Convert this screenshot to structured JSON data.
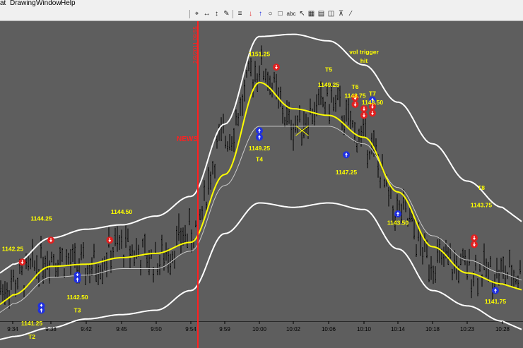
{
  "menu": {
    "items": [
      "at",
      "Drawing",
      "Window",
      "Help"
    ]
  },
  "toolbar": {
    "tools": [
      "crosshair-icon",
      "horizontal-arrows-icon",
      "vertical-arrows-icon",
      "pencil-icon",
      "lines-icon",
      "down-arrow-icon",
      "up-arrow-icon",
      "circle-icon",
      "square-icon",
      "text-icon",
      "pointer-icon",
      "grid-icon",
      "table-icon",
      "chart-icon",
      "magnet-icon"
    ],
    "text_tool_label": "abc"
  },
  "colors": {
    "background": "#5e5e5e",
    "bars": "#000000",
    "sma": "#ffff00",
    "ema": "#cccccc",
    "bands": "#ffffff",
    "news_line": "#ff2020",
    "sell": "#e02020",
    "buy": "#2030e0",
    "label": "#ffff00"
  },
  "news": {
    "label": "NEWS",
    "time": "9:54",
    "stamp": "2/9/2011 09:55"
  },
  "chart_data": {
    "type": "line",
    "title": "",
    "xlabel": "",
    "ylabel": "",
    "x": [
      "9:34",
      "9:38",
      "9:42",
      "9:45",
      "9:50",
      "9:54",
      "9:59",
      "10:00",
      "10:02",
      "10:06",
      "10:10",
      "10:14",
      "10:18",
      "10:23",
      "10:28"
    ],
    "ylim": [
      1139.6,
      1153.3
    ],
    "series": [
      {
        "values": [
          1141.4,
          1142.6,
          1142.0,
          1143.0,
          1142.4,
          1143.6,
          1148.0,
          1151.2,
          1148.6,
          1149.6,
          1148.0,
          1144.6,
          1142.4,
          1142.0,
          1141.8
        ]
      }
    ],
    "sma": [
      1140.8,
      1142.1,
      1142.2,
      1142.5,
      1142.7,
      1143.2,
      1146.3,
      1150.5,
      1149.3,
      1149.0,
      1148.0,
      1145.5,
      1143.0,
      1141.8,
      1141.3
    ],
    "ema": [
      1140.4,
      1141.6,
      1141.7,
      1142.0,
      1142.0,
      1142.8,
      1145.8,
      1148.5,
      1148.5,
      1148.5,
      1147.7,
      1145.7,
      1143.5,
      1142.4,
      1141.8
    ],
    "upper": [
      1142.2,
      1143.4,
      1143.8,
      1144.0,
      1144.4,
      1145.3,
      1148.6,
      1152.6,
      1152.7,
      1152.4,
      1151.3,
      1149.6,
      1147.7,
      1146.0,
      1144.8
    ],
    "lower": [
      1138.9,
      1139.3,
      1139.7,
      1139.9,
      1140.1,
      1141.0,
      1143.6,
      1145.0,
      1144.8,
      1145.0,
      1144.7,
      1142.9,
      1141.0,
      1140.3,
      1139.6
    ],
    "signals": [
      {
        "type": "sell",
        "time": "9:35",
        "price": 1142.3
      },
      {
        "type": "buy",
        "time": "9:37",
        "price": 1140.3
      },
      {
        "type": "buy",
        "time": "9:37",
        "price": 1140.1
      },
      {
        "type": "sell",
        "time": "9:38",
        "price": 1143.3
      },
      {
        "type": "buy",
        "time": "9:41",
        "price": 1141.7
      },
      {
        "type": "buy",
        "time": "9:41",
        "price": 1141.5
      },
      {
        "type": "sell",
        "time": "9:44",
        "price": 1143.3
      },
      {
        "type": "buy",
        "time": "10:00",
        "price": 1148.3
      },
      {
        "type": "buy",
        "time": "10:00",
        "price": 1148.0
      },
      {
        "type": "sell",
        "time": "10:01",
        "price": 1151.2
      },
      {
        "type": "buy",
        "time": "10:08",
        "price": 1147.2
      },
      {
        "type": "sell",
        "time": "10:09",
        "price": 1149.8
      },
      {
        "type": "sell",
        "time": "10:09",
        "price": 1149.5
      },
      {
        "type": "sell",
        "time": "10:10",
        "price": 1149.3
      },
      {
        "type": "sell",
        "time": "10:10",
        "price": 1149.0
      },
      {
        "type": "buy",
        "time": "10:11",
        "price": 1149.7
      },
      {
        "type": "sell",
        "time": "10:11",
        "price": 1149.4
      },
      {
        "type": "sell",
        "time": "10:11",
        "price": 1149.1
      },
      {
        "type": "buy",
        "time": "10:14",
        "price": 1144.5
      },
      {
        "type": "sell",
        "time": "10:24",
        "price": 1143.4
      },
      {
        "type": "sell",
        "time": "10:24",
        "price": 1143.1
      },
      {
        "type": "buy",
        "time": "10:27",
        "price": 1141.0
      }
    ],
    "annotations": [
      {
        "text": "1142.25",
        "time": "9:34",
        "price": 1142.8
      },
      {
        "text": "1144.25",
        "time": "9:37",
        "price": 1144.2
      },
      {
        "text": "1141.25",
        "time": "9:36",
        "price": 1139.4
      },
      {
        "text": "T2",
        "time": "9:36",
        "price": 1138.8
      },
      {
        "text": "1142.50",
        "time": "9:41",
        "price": 1140.6
      },
      {
        "text": "T3",
        "time": "9:41",
        "price": 1140.0
      },
      {
        "text": "1144.50",
        "time": "9:45",
        "price": 1144.5
      },
      {
        "text": "1151.25",
        "time": "10:00",
        "price": 1151.7
      },
      {
        "text": "1149.25",
        "time": "10:00",
        "price": 1147.4
      },
      {
        "text": "T4",
        "time": "10:00",
        "price": 1146.9
      },
      {
        "text": "T5",
        "time": "10:06",
        "price": 1151.0
      },
      {
        "text": "1149.25",
        "time": "10:06",
        "price": 1150.3
      },
      {
        "text": "vol trigger",
        "time": "10:10",
        "price": 1151.8
      },
      {
        "text": "hit",
        "time": "10:10",
        "price": 1151.4
      },
      {
        "text": "T6",
        "time": "10:09",
        "price": 1150.2
      },
      {
        "text": "1148.75",
        "time": "10:09",
        "price": 1149.8
      },
      {
        "text": "T7",
        "time": "10:11",
        "price": 1149.9
      },
      {
        "text": "1148.50",
        "time": "10:11",
        "price": 1149.5
      },
      {
        "text": "1147.25",
        "time": "10:08",
        "price": 1146.3
      },
      {
        "text": "1143.50",
        "time": "10:14",
        "price": 1144.0
      },
      {
        "text": "T8",
        "time": "10:25",
        "price": 1145.6
      },
      {
        "text": "1143.75",
        "time": "10:25",
        "price": 1144.8
      },
      {
        "text": "1141.75",
        "time": "10:27",
        "price": 1140.4
      },
      {
        "text": "1.25",
        "time": "9:32",
        "price": 1138.8
      }
    ]
  }
}
